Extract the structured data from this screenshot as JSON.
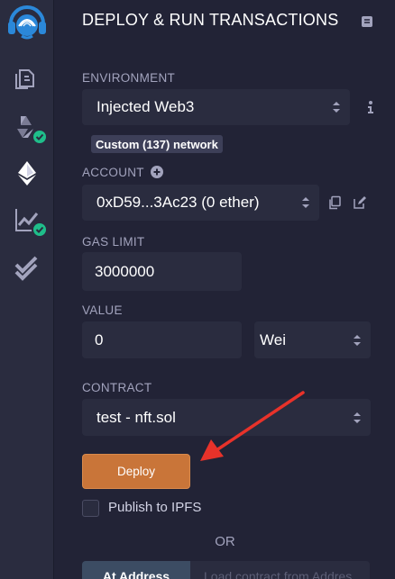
{
  "sidebar": {
    "icons": [
      "remix-logo-icon",
      "file-explorer-icon",
      "solidity-compiler-icon",
      "deploy-run-icon",
      "analysis-icon",
      "verify-icon"
    ]
  },
  "panel": {
    "title": "DEPLOY & RUN TRANSACTIONS",
    "environment": {
      "label": "ENVIRONMENT",
      "value": "Injected Web3",
      "network_badge": "Custom (137) network"
    },
    "account": {
      "label": "ACCOUNT",
      "value": "0xD59...3Ac23 (0 ether)"
    },
    "gas_limit": {
      "label": "GAS LIMIT",
      "value": "3000000"
    },
    "value": {
      "label": "VALUE",
      "amount": "0",
      "unit": "Wei"
    },
    "contract": {
      "label": "CONTRACT",
      "value": "test - nft.sol"
    },
    "deploy_label": "Deploy",
    "publish_label": "Publish to IPFS",
    "or_label": "OR",
    "at_address_label": "At Address",
    "load_placeholder": "Load contract from Addres"
  },
  "colors": {
    "background": "#222336",
    "sidebar": "#2a2c3f",
    "accent_orange": "#c97539",
    "check_green": "#1fbe8a",
    "annotation_red": "#e8322a"
  }
}
